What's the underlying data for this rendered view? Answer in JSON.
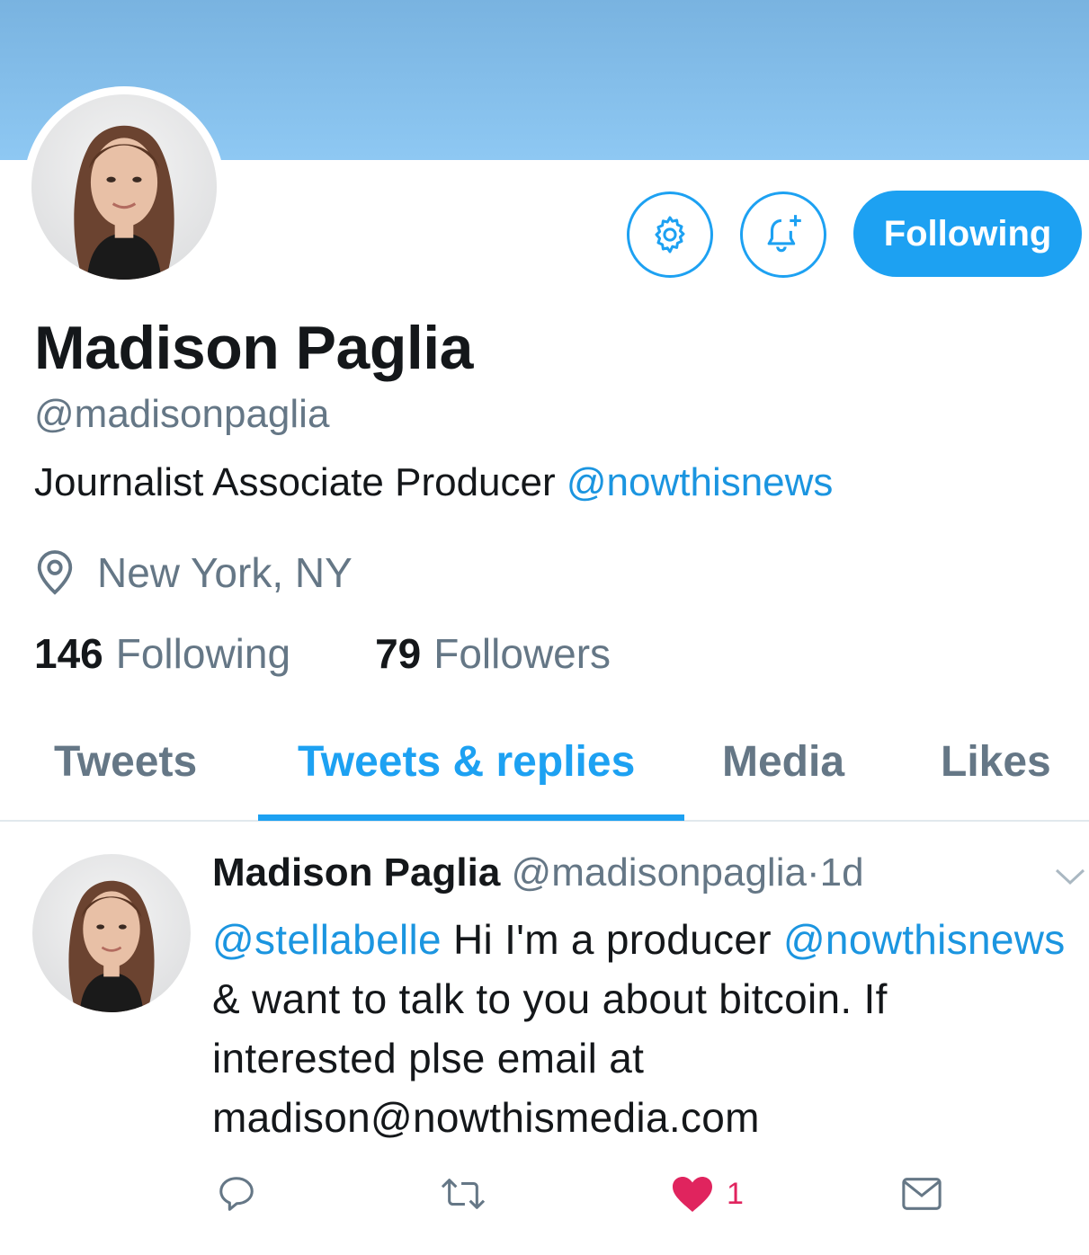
{
  "profile": {
    "name": "Madison Paglia",
    "handle": "@madisonpaglia",
    "bio_text": "Journalist Associate Producer ",
    "bio_mention": "@nowthisnews",
    "location": "New York, NY",
    "following_count": "146",
    "following_label": "Following",
    "followers_count": "79",
    "followers_label": "Followers"
  },
  "actions": {
    "settings_icon": "gear-icon",
    "notify_icon": "bell-plus-icon",
    "follow_button_label": "Following"
  },
  "tabs": [
    {
      "label": "Tweets"
    },
    {
      "label": "Tweets & replies",
      "active": true
    },
    {
      "label": "Media"
    },
    {
      "label": "Likes"
    }
  ],
  "tweet": {
    "author_name": "Madison Paglia",
    "author_handle": "@madisonpaglia",
    "separator": "·",
    "time": "1d",
    "mention_1": "@stellabelle",
    "text_1": " Hi I'm a producer ",
    "mention_2": "@nowthisnews",
    "text_2": " & want to talk to you about bitcoin. If interested plse email at madison@nowthismedia.com",
    "like_count": "1"
  },
  "colors": {
    "accent": "#1da1f2",
    "link": "#1b95e0",
    "secondary_text": "#657786",
    "like": "#e0245e",
    "banner": "#8ec8f3"
  }
}
